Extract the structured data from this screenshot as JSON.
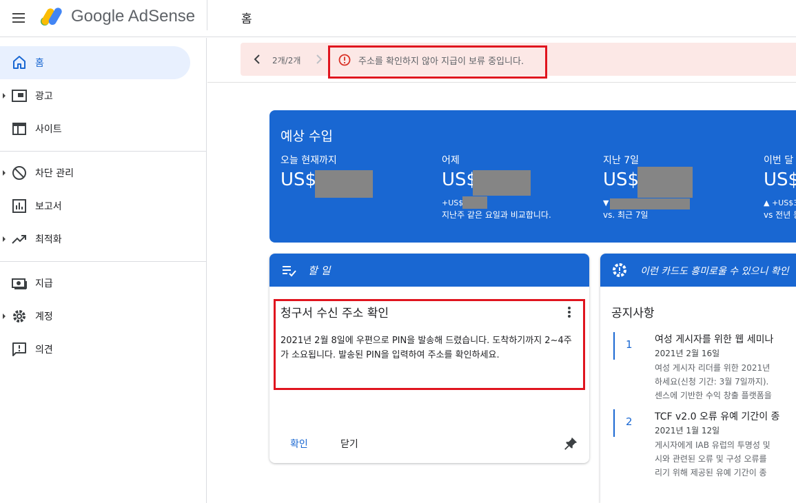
{
  "app": {
    "brand": "Google AdSense",
    "page_title": "홈"
  },
  "icons": {
    "menu": "hamburger-menu-icon",
    "logo": "adsense-logo-icon",
    "alert": "error-circle-icon",
    "pin": "pin-icon",
    "more": "more-vert-icon",
    "todo": "playlist-check-icon",
    "suggest": "gear-alert-icon"
  },
  "colors": {
    "accent": "#1967d2",
    "alert_bg": "#fce8e6",
    "highlight": "#e0141e"
  },
  "sidebar": {
    "items": [
      {
        "label": "홈",
        "icon": "home-icon",
        "active": true
      },
      {
        "label": "광고",
        "icon": "ad-frame-icon",
        "expandable": true
      },
      {
        "label": "사이트",
        "icon": "web-window-icon"
      },
      {
        "label": "차단 관리",
        "icon": "block-icon",
        "expandable": true
      },
      {
        "label": "보고서",
        "icon": "bar-chart-icon"
      },
      {
        "label": "최적화",
        "icon": "trending-up-icon",
        "expandable": true
      },
      {
        "label": "지급",
        "icon": "payments-icon"
      },
      {
        "label": "계정",
        "icon": "settings-icon",
        "expandable": true
      },
      {
        "label": "의견",
        "icon": "feedback-icon"
      }
    ]
  },
  "notice": {
    "pager": "2개/2개",
    "message": "주소를 확인하지 않아 지급이 보류 중입니다."
  },
  "earnings": {
    "title": "예상 수입",
    "columns": [
      {
        "label": "오늘 현재까지",
        "currency": "US$",
        "delta": "",
        "compare": ""
      },
      {
        "label": "어제",
        "currency": "US$",
        "delta": "+US$",
        "compare": "지난주 같은 요일과 비교합니다."
      },
      {
        "label": "지난 7일",
        "currency": "US$",
        "delta": "▼",
        "compare": "vs. 최근 7일"
      },
      {
        "label": "이번 달",
        "currency": "US$",
        "delta": "▲ +US$3",
        "compare": "vs 전년 동"
      }
    ]
  },
  "todo": {
    "header": "할 일",
    "task_title": "청구서 수신 주소 확인",
    "task_body": "2021년 2월 8일에 우편으로 PIN을 발송해 드렸습니다. 도착하기까지 2~4주가 소요됩니다. 발송된 PIN을 입력하여 주소를 확인하세요.",
    "confirm_label": "확인",
    "close_label": "닫기"
  },
  "news": {
    "header": "이런 카드도 흥미로울 수 있으니 확인",
    "section_title": "공지사항",
    "items": [
      {
        "num": "1",
        "title": "여성 게시자를 위한 웹 세미나",
        "date": "2021년 2월 16일",
        "lines": [
          "여성 게시자 리더를 위한 2021년",
          "하세요(신청 기간: 3월 7일까지).",
          "센스에 기반한 수익 창출 플랫폼을"
        ]
      },
      {
        "num": "2",
        "title": "TCF v2.0 오류 유예 기간이 종",
        "date": "2021년 1월 12일",
        "lines": [
          "게시자에게 IAB 유럽의 투명성 및",
          "시와 관련된 오류 및 구성 오류를",
          "리기 위해 제공된 유예 기간이 종"
        ]
      }
    ]
  }
}
